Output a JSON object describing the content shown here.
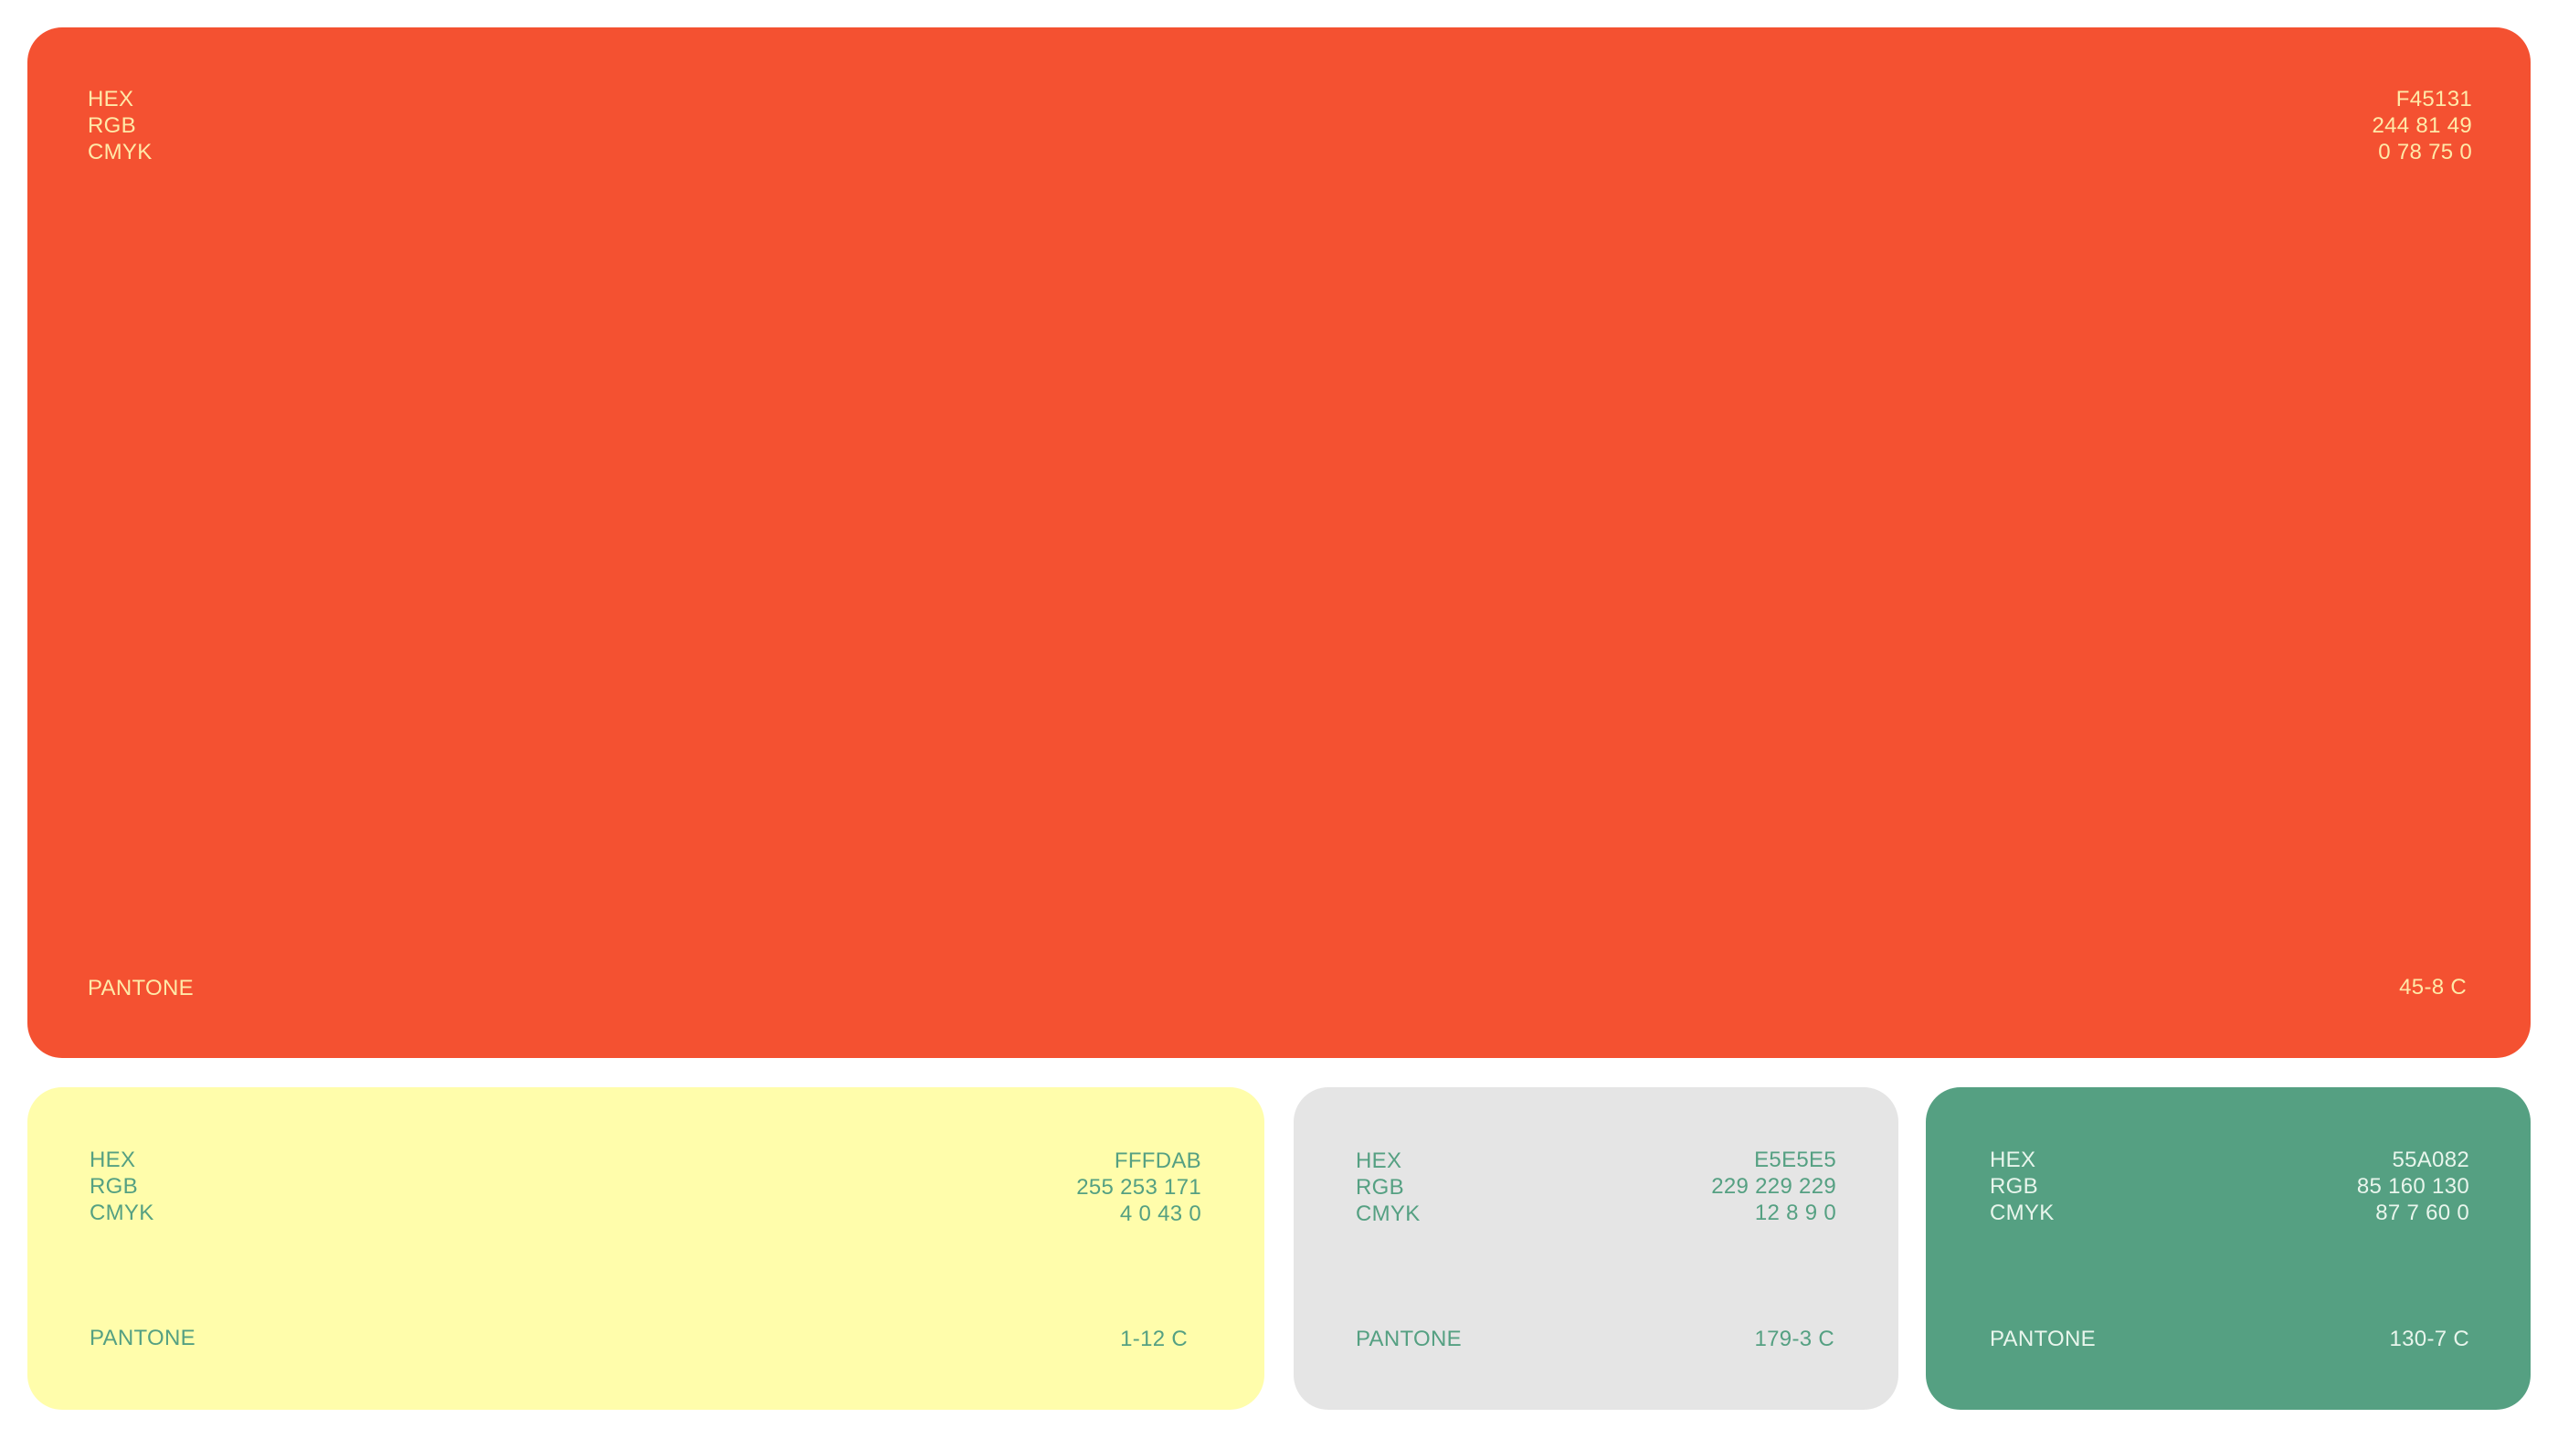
{
  "swatches": [
    {
      "id": "primary-orange",
      "background": "#F45131",
      "text_color": "#FFE9A8",
      "labels": {
        "hex": "HEX",
        "rgb": "RGB",
        "cmyk": "CMYK",
        "pantone": "PANTONE"
      },
      "values": {
        "hex": "F45131",
        "rgb": "244 81 49",
        "cmyk": "0 78 75 0",
        "pantone": "45-8 C"
      }
    },
    {
      "id": "light-yellow",
      "background": "#FFFDAB",
      "text_color": "#55A082",
      "labels": {
        "hex": "HEX",
        "rgb": "RGB",
        "cmyk": "CMYK",
        "pantone": "PANTONE"
      },
      "values": {
        "hex": "FFFDAB",
        "rgb": "255 253 171",
        "cmyk": "4 0 43 0",
        "pantone": "1-12 C"
      }
    },
    {
      "id": "light-grey",
      "background": "#E5E5E5",
      "text_color": "#55A082",
      "labels": {
        "hex": "HEX",
        "rgb": "RGB",
        "cmyk": "CMYK",
        "pantone": "PANTONE"
      },
      "values": {
        "hex": "E5E5E5",
        "rgb": "229 229 229",
        "cmyk": "12 8 9 0",
        "pantone": "179-3 C"
      }
    },
    {
      "id": "green",
      "background": "#55A082",
      "text_color": "#E8F5EC",
      "labels": {
        "hex": "HEX",
        "rgb": "RGB",
        "cmyk": "CMYK",
        "pantone": "PANTONE"
      },
      "values": {
        "hex": "55A082",
        "rgb": "85 160 130",
        "cmyk": "87 7 60 0",
        "pantone": "130-7 C"
      }
    }
  ]
}
